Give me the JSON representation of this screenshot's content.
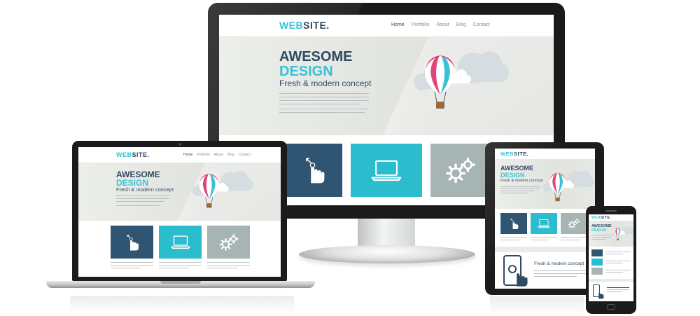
{
  "desktop": {
    "logo_part1": "WEB",
    "logo_part2": "SITE.",
    "nav": [
      "Home",
      "Portfolio",
      "About",
      "Blog",
      "Contact"
    ],
    "headline1": "AWESOME",
    "headline2": "DESIGN",
    "tagline": "Fresh & modern concept"
  },
  "laptop": {
    "logo_part1": "WEB",
    "logo_part2": "SITE.",
    "nav": [
      "Home",
      "Portfolio",
      "About",
      "Blog",
      "Contact"
    ],
    "headline1": "AWESOME",
    "headline2": "DESIGN",
    "tagline": "Fresh & modern concept"
  },
  "tablet": {
    "logo_part1": "WEB",
    "logo_part2": "SITE.",
    "headline1": "AWESOME",
    "headline2": "DESIGN",
    "tagline": "Fresh & modern concept",
    "section_title": "Fresh & modern concept"
  },
  "phone": {
    "logo_part1": "WEB",
    "logo_part2": "SITE.",
    "headline1": "AWESOME",
    "headline2": "DESIGN"
  },
  "colors": {
    "navy": "#2f4a63",
    "cyan": "#39c2d6",
    "tile_blue": "#2f5573",
    "tile_cyan": "#2bbccd",
    "tile_grey": "#a6b4b4",
    "balloon_pink": "#e0457b"
  },
  "icons": [
    "touch-hand-icon",
    "laptop-icon",
    "gears-icon",
    "hot-air-balloon-icon",
    "cloud-icon"
  ]
}
